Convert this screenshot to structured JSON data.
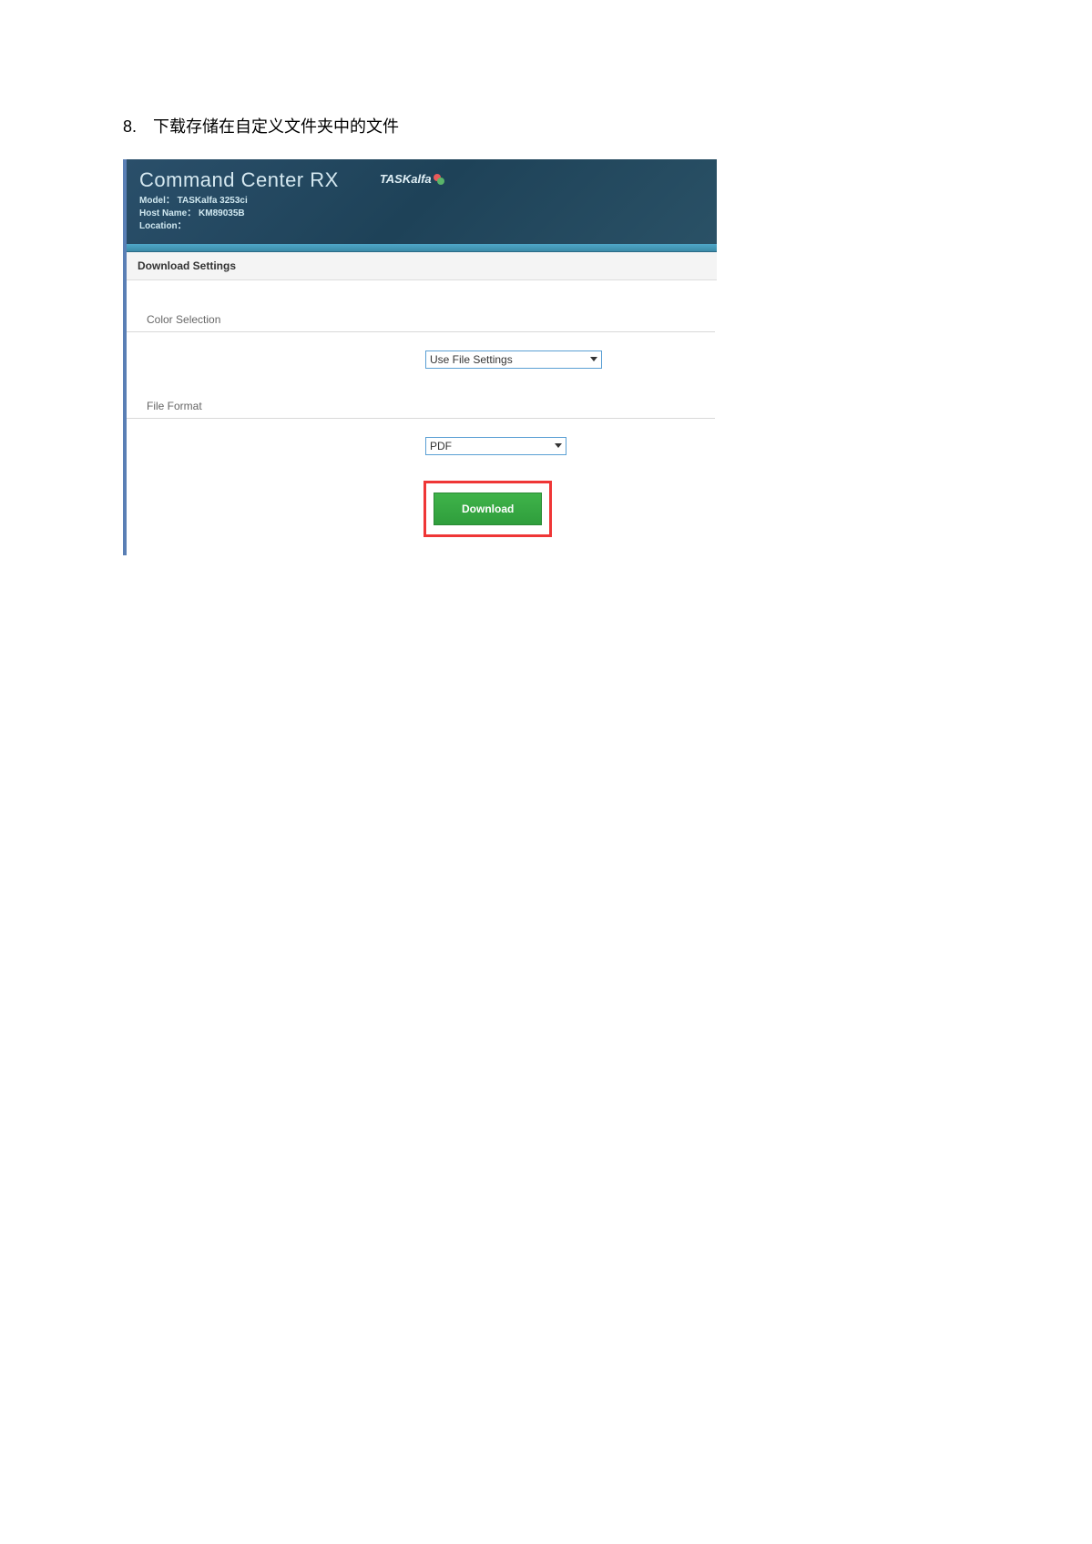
{
  "step": {
    "number": "8.",
    "text": "下载存储在自定义文件夹中的文件"
  },
  "header": {
    "title": "Command Center RX",
    "model_label": "Model：",
    "model_value": "TASKalfa 3253ci",
    "hostname_label": "Host Name：",
    "hostname_value": "KM89035B",
    "location_label": "Location：",
    "location_value": "",
    "brand_text": "TASKalfa"
  },
  "panel": {
    "heading": "Download Settings",
    "color_section_label": "Color Selection",
    "color_selected": "Use File Settings",
    "format_section_label": "File Format",
    "format_selected": "PDF",
    "download_button": "Download"
  }
}
